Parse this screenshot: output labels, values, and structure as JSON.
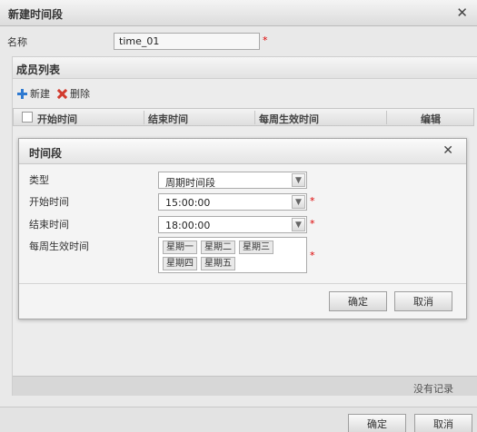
{
  "window": {
    "title": "新建时间段"
  },
  "form": {
    "name_label": "名称",
    "name_value": "time_01"
  },
  "members": {
    "title": "成员列表",
    "toolbar": {
      "add_label": "新建",
      "delete_label": "删除"
    },
    "columns": [
      "开始时间",
      "结束时间",
      "每周生效时间",
      "编辑"
    ],
    "empty_text": "没有记录"
  },
  "dialog": {
    "title": "时间段",
    "type_label": "类型",
    "type_value": "周期时间段",
    "start_label": "开始时间",
    "start_value": "15:00:00",
    "end_label": "结束时间",
    "end_value": "18:00:00",
    "weekdays_label": "每周生效时间",
    "weekdays": [
      "星期一",
      "星期二",
      "星期三",
      "星期四",
      "星期五"
    ],
    "ok_label": "确定",
    "cancel_label": "取消"
  },
  "footer": {
    "ok_label": "确定",
    "cancel_label": "取消"
  },
  "icons": {
    "close": "close-icon",
    "add": "plus-icon",
    "delete": "delete-icon",
    "dropdown": "chevron-down-icon"
  },
  "colors": {
    "required": "#dd0000",
    "add_icon": "#2f7ad1",
    "delete_icon": "#d23b2e"
  }
}
